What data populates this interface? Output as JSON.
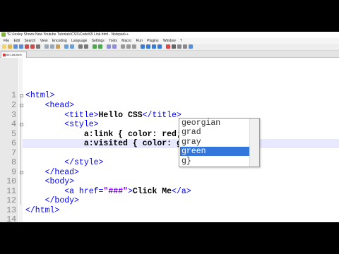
{
  "window": {
    "title": "*E:\\Jesley Shows New Youtube Tutorials\\CSS\\Code\\65 Link.html - Notepad++"
  },
  "menu": [
    "File",
    "Edit",
    "Search",
    "View",
    "Encoding",
    "Language",
    "Settings",
    "Tools",
    "Macro",
    "Run",
    "Plugins",
    "Window",
    "?"
  ],
  "tab": {
    "label": "65 Link.html"
  },
  "editor": {
    "line_numbers": [
      "1",
      "2",
      "3",
      "4",
      "5",
      "6",
      "7",
      "8",
      "9",
      "10",
      "11",
      "12",
      "13",
      "14"
    ],
    "current_line": 6
  },
  "autocomplete": {
    "items": [
      "georgian",
      "grad",
      "gray",
      "green",
      "g}"
    ],
    "selected": "green"
  },
  "colors": {
    "tag": "#0000ff",
    "string": "#8000ff",
    "current_line_bg": "#e8e8ff",
    "autocomplete_selected": "#3377dd"
  }
}
